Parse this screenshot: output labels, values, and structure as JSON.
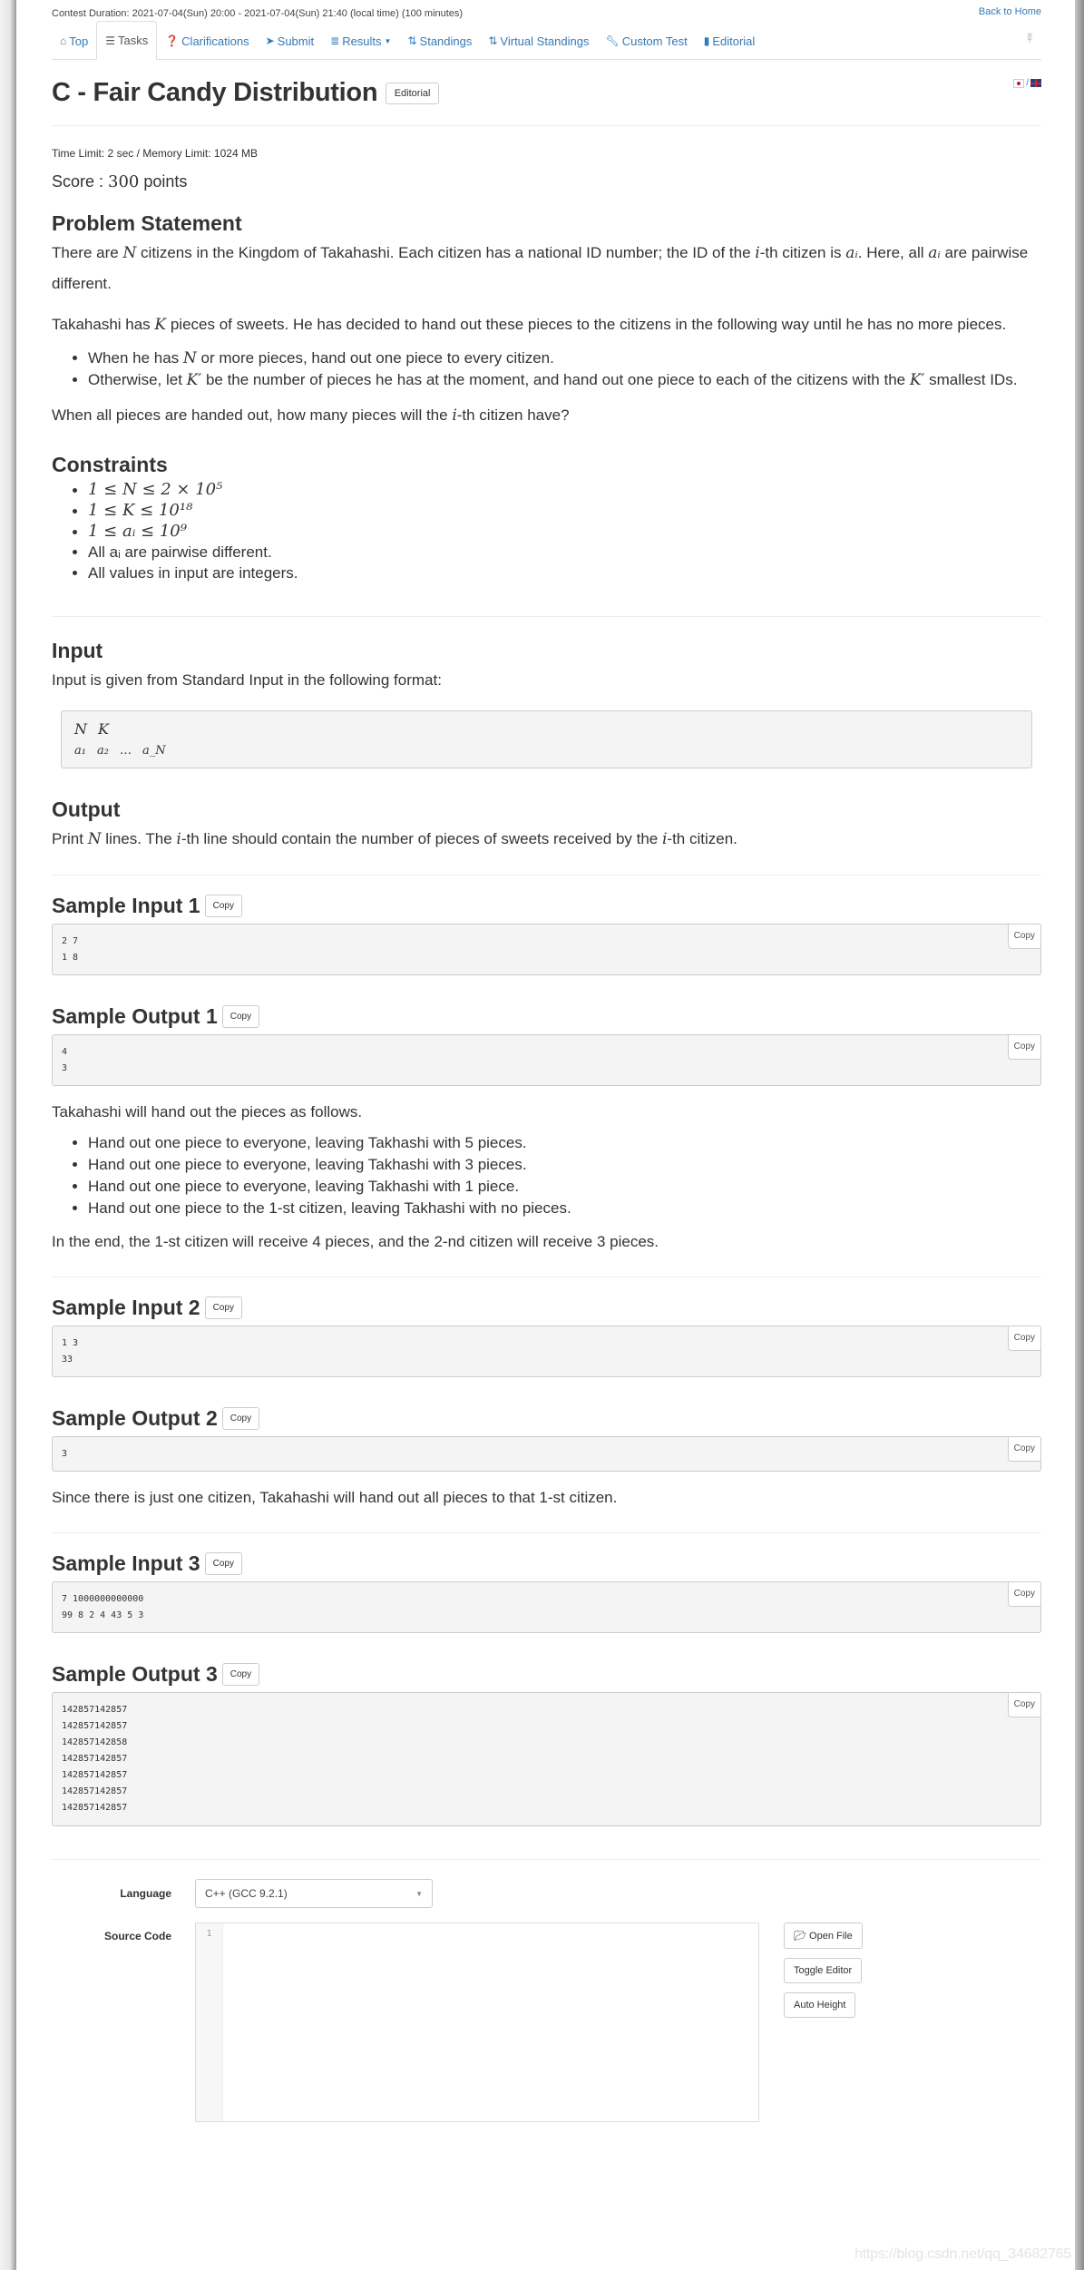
{
  "header": {
    "contest_duration": "Contest Duration: 2021-07-04(Sun) 20:00 - 2021-07-04(Sun) 21:40 (local time) (100 minutes)",
    "back_home": "Back to Home"
  },
  "nav": {
    "tabs": [
      {
        "label": "Top",
        "icon": "home-icon",
        "active": false
      },
      {
        "label": "Tasks",
        "icon": "tasks-icon",
        "active": true
      },
      {
        "label": "Clarifications",
        "icon": "question-circle-icon",
        "active": false
      },
      {
        "label": "Submit",
        "icon": "send-icon",
        "active": false
      },
      {
        "label": "Results",
        "icon": "list-icon",
        "active": false,
        "dropdown": true
      },
      {
        "label": "Standings",
        "icon": "sort-icon",
        "active": false
      },
      {
        "label": "Virtual Standings",
        "icon": "sort-icon",
        "active": false
      },
      {
        "label": "Custom Test",
        "icon": "wrench-icon",
        "active": false
      },
      {
        "label": "Editorial",
        "icon": "book-icon",
        "active": false
      }
    ],
    "pin_icon": "pin-icon"
  },
  "task": {
    "title": "C - Fair Candy Distribution",
    "editorial_button": "Editorial",
    "lang_separator": "/",
    "limits": "Time Limit: 2 sec / Memory Limit: 1024 MB",
    "score_prefix": "Score : ",
    "score_value": "300",
    "score_suffix": " points"
  },
  "statement": {
    "heading": "Problem Statement",
    "p1": [
      "There are ",
      "N",
      " citizens in the Kingdom of Takahashi. Each citizen has a national ID number; the ID of the ",
      "i",
      "-th citizen is ",
      "aᵢ",
      ". Here, all ",
      "aᵢ",
      " are pairwise different."
    ],
    "p2": [
      "Takahashi has ",
      "K",
      " pieces of sweets. He has decided to hand out these pieces to the citizens in the following way until he has no more pieces."
    ],
    "bullets": [
      [
        "When he has ",
        "N",
        " or more pieces, hand out one piece to every citizen."
      ],
      [
        "Otherwise, let ",
        "K′",
        " be the number of pieces he has at the moment, and hand out one piece to each of the citizens with the ",
        "K′",
        " smallest IDs."
      ]
    ],
    "p3": [
      "When all pieces are handed out, how many pieces will the ",
      "i",
      "-th citizen have?"
    ]
  },
  "constraints": {
    "heading": "Constraints",
    "items": [
      "1 ≤ N ≤ 2 × 10⁵",
      "1 ≤ K ≤ 10¹⁸",
      "1 ≤ aᵢ ≤ 10⁹",
      "All aᵢ are pairwise different.",
      "All values in input are integers."
    ]
  },
  "input": {
    "heading": "Input",
    "text": "Input is given from Standard Input in the following format:",
    "format_line1": [
      "N",
      "K"
    ],
    "format_line2": [
      "a₁",
      "a₂",
      "…",
      "a_N"
    ]
  },
  "output": {
    "heading": "Output",
    "text": [
      "Print ",
      "N",
      " lines. The ",
      "i",
      "-th line should contain the number of pieces of sweets received by the ",
      "i",
      "-th citizen."
    ]
  },
  "samples": [
    {
      "input_heading": "Sample Input 1",
      "input": "2 7\n1 8",
      "output_heading": "Sample Output 1",
      "output": "4\n3",
      "explanation_intro": "Takahashi will hand out the pieces as follows.",
      "explanation_bullets": [
        "Hand out one piece to everyone, leaving Takhashi with 5 pieces.",
        "Hand out one piece to everyone, leaving Takhashi with 3 pieces.",
        "Hand out one piece to everyone, leaving Takhashi with 1 piece.",
        "Hand out one piece to the 1-st citizen, leaving Takhashi with no pieces."
      ],
      "explanation_end": "In the end, the 1-st citizen will receive 4 pieces, and the 2-nd citizen will receive 3 pieces."
    },
    {
      "input_heading": "Sample Input 2",
      "input": "1 3\n33",
      "output_heading": "Sample Output 2",
      "output": "3",
      "explanation_end": "Since there is just one citizen, Takahashi will hand out all pieces to that 1-st citizen."
    },
    {
      "input_heading": "Sample Input 3",
      "input": "7 1000000000000\n99 8 2 4 43 5 3",
      "output_heading": "Sample Output 3",
      "output": "142857142857\n142857142857\n142857142858\n142857142857\n142857142857\n142857142857\n142857142857"
    }
  ],
  "copy_label": "Copy",
  "submit_form": {
    "language_label": "Language",
    "language_value": "C++ (GCC 9.2.1)",
    "source_label": "Source Code",
    "line_number": "1",
    "open_file": "Open File",
    "toggle_editor": "Toggle Editor",
    "auto_height": "Auto Height"
  },
  "watermark": "https://blog.csdn.net/qq_34682765"
}
